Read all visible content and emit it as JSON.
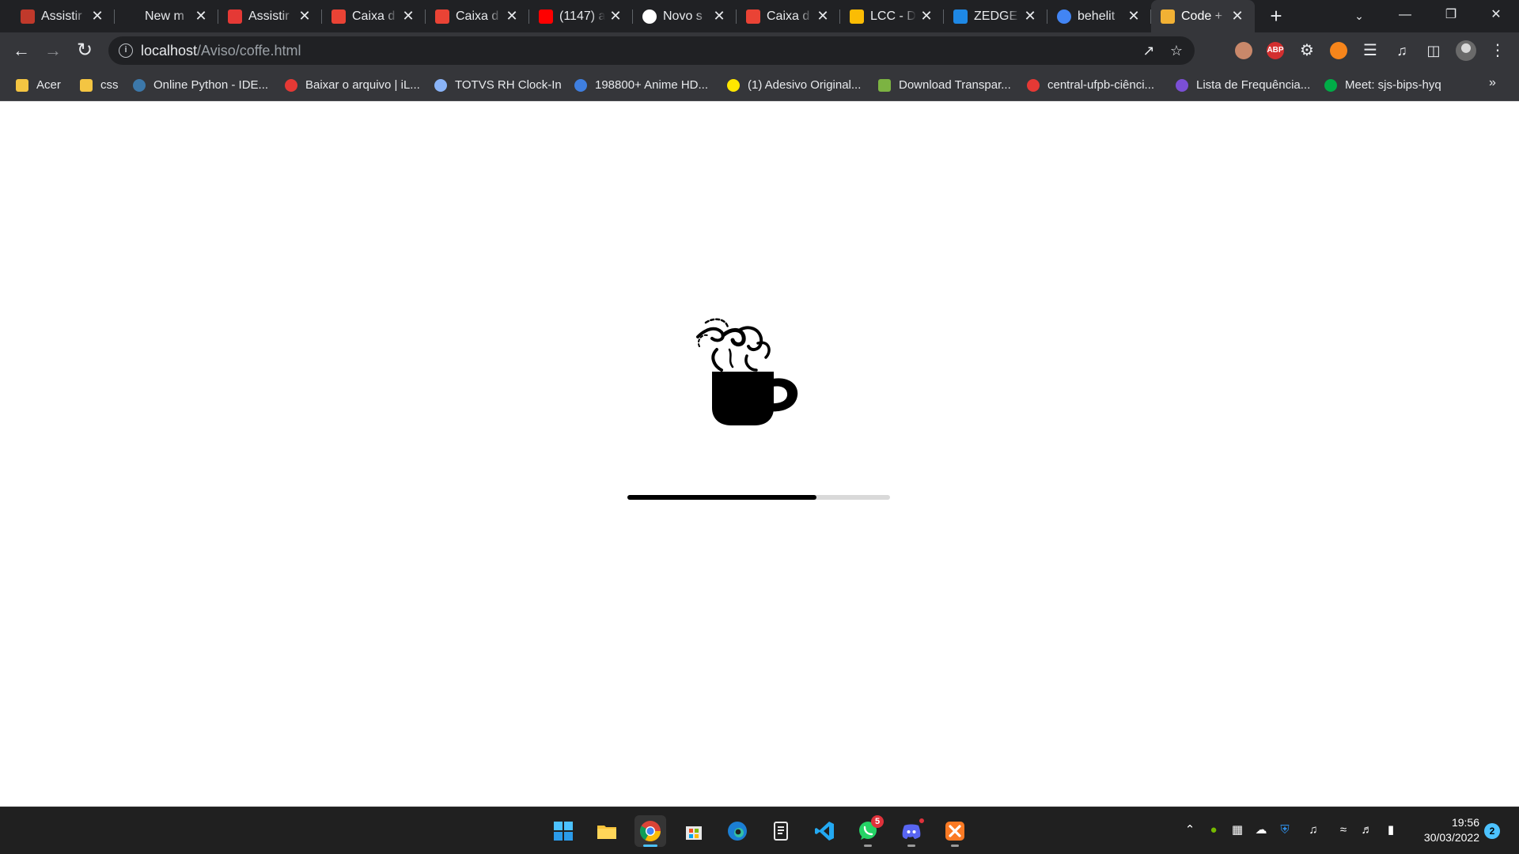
{
  "browser": {
    "tabs": [
      {
        "title": "Assistir",
        "icon": "anime-site-icon",
        "color": "#c0392b"
      },
      {
        "title": "New m",
        "icon": "blank-page-icon",
        "color": "#202124"
      },
      {
        "title": "Assistir",
        "icon": "youtube-play-icon",
        "color": "#e53935"
      },
      {
        "title": "Caixa d",
        "icon": "gmail-icon",
        "color": "#ea4335"
      },
      {
        "title": "Caixa d",
        "icon": "gmail-icon",
        "color": "#ea4335"
      },
      {
        "title": "(1147) a",
        "icon": "youtube-icon",
        "color": "#ff0000"
      },
      {
        "title": "Novo s",
        "icon": "openai-icon",
        "color": "#ffffff"
      },
      {
        "title": "Caixa d",
        "icon": "gmail-icon",
        "color": "#ea4335"
      },
      {
        "title": "LCC - D",
        "icon": "google-drive-icon",
        "color": "#fbbc04"
      },
      {
        "title": "ZEDGE",
        "icon": "zedge-icon",
        "color": "#1e88e5"
      },
      {
        "title": "behelit",
        "icon": "google-icon",
        "color": "#4285f4"
      },
      {
        "title": "Code +",
        "icon": "coffee-cup-icon",
        "color": "#f2b134"
      }
    ],
    "active_tab_index": 11,
    "address": {
      "host": "localhost",
      "path": "/Aviso/coffe.html"
    },
    "bookmarks": [
      {
        "label": "Acer",
        "icon": "folder-icon",
        "color": "#f4c542"
      },
      {
        "label": "css",
        "icon": "folder-icon",
        "color": "#f4c542"
      },
      {
        "label": "Online Python - IDE...",
        "icon": "python-icon",
        "color": "#3c78aa"
      },
      {
        "label": "Baixar o arquivo | iL...",
        "icon": "heart-icon",
        "color": "#e53935"
      },
      {
        "label": "TOTVS RH Clock-In",
        "icon": "clock-in-icon",
        "color": "#8ab4f8"
      },
      {
        "label": "198800+ Anime HD...",
        "icon": "wallpaper-site-icon",
        "color": "#3f7fe0"
      },
      {
        "label": "(1) Adesivo Original...",
        "icon": "mercado-livre-icon",
        "color": "#ffe600"
      },
      {
        "label": "Download Transpar...",
        "icon": "pngtree-icon",
        "color": "#7cb342"
      },
      {
        "label": "central-ufpb-ciênci...",
        "icon": "ufpb-icon",
        "color": "#e53935"
      },
      {
        "label": "Lista de Frequência...",
        "icon": "forms-list-icon",
        "color": "#7b4fd6"
      },
      {
        "label": "Meet: sjs-bips-hyq",
        "icon": "google-meet-icon",
        "color": "#00ac47"
      }
    ],
    "extensions": [
      {
        "name": "privacy-badger-icon",
        "text": "",
        "color": "#c9886a"
      },
      {
        "name": "adblock-plus-icon",
        "text": "ABP",
        "color": "#d32f2f"
      },
      {
        "name": "settings-gear-extension-icon",
        "text": "",
        "color": "#35363a"
      },
      {
        "name": "metamask-fox-icon",
        "text": "",
        "color": "#f6851b"
      }
    ]
  },
  "page": {
    "progress": 0.72
  },
  "taskbar": {
    "apps": [
      {
        "name": "windows-start-icon",
        "badge": ""
      },
      {
        "name": "file-explorer-icon",
        "badge": ""
      },
      {
        "name": "chrome-icon",
        "badge": ""
      },
      {
        "name": "microsoft-store-icon",
        "badge": ""
      },
      {
        "name": "edge-icon",
        "badge": ""
      },
      {
        "name": "notepad-icon",
        "badge": ""
      },
      {
        "name": "vscode-icon",
        "badge": ""
      },
      {
        "name": "whatsapp-icon",
        "badge": "5"
      },
      {
        "name": "discord-icon",
        "badge": ""
      },
      {
        "name": "xampp-icon",
        "badge": ""
      }
    ],
    "time": "19:56",
    "date": "30/03/2022",
    "notifications": "2"
  }
}
